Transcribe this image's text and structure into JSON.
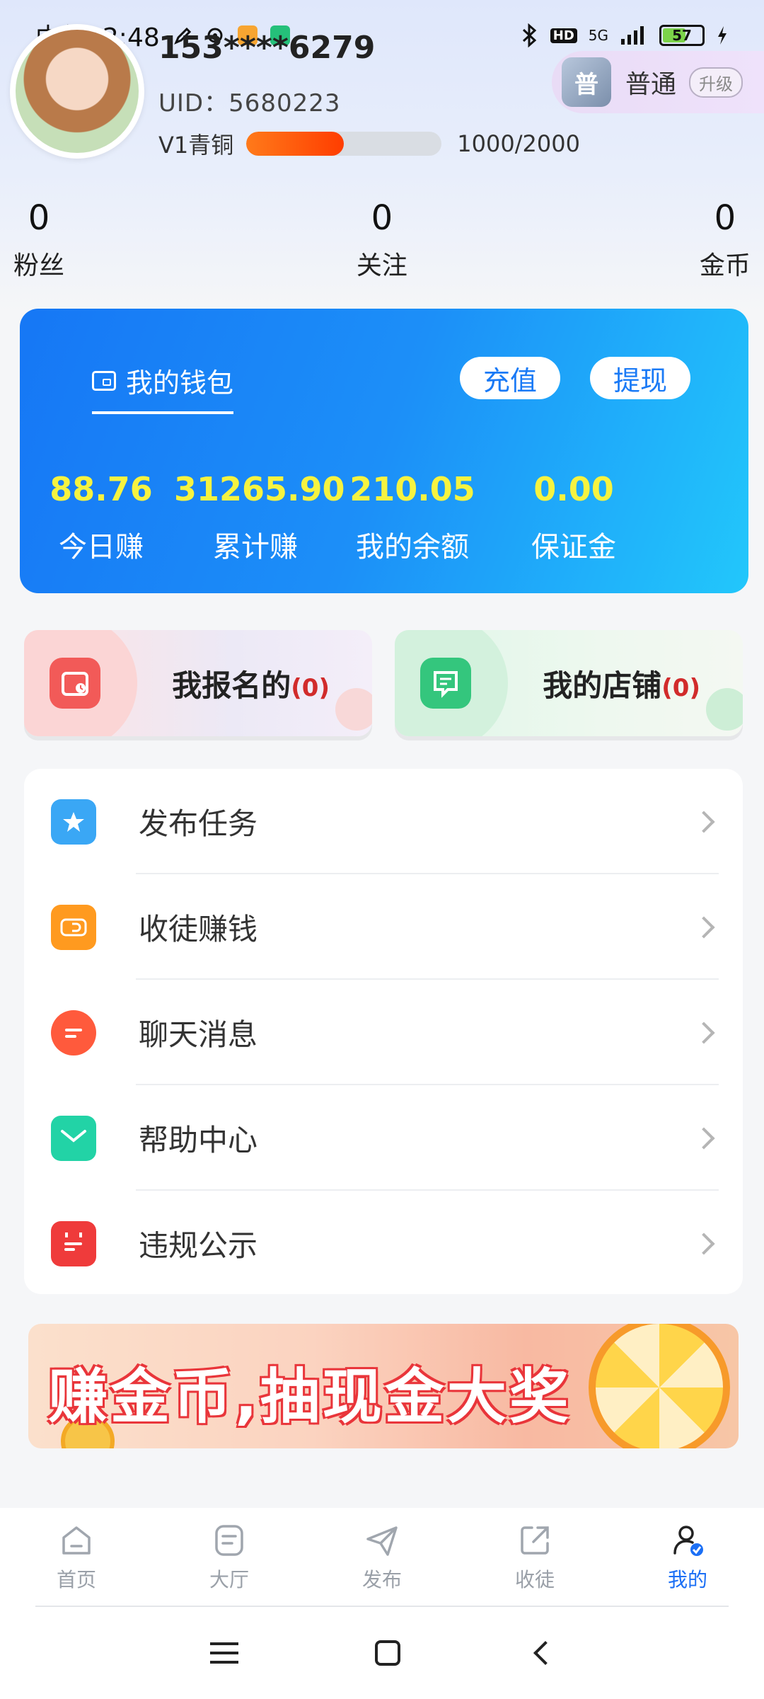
{
  "status_bar": {
    "time": "中午12:48",
    "network": "5G",
    "hd": "HD",
    "battery": "57"
  },
  "profile": {
    "username": "153****6279",
    "uid_label": "UID：5680223",
    "level_name": "V1青铜",
    "level_progress_text": "1000/2000",
    "level_progress_fraction": 0.5,
    "member": {
      "badge_glyph": "普",
      "tier": "普通",
      "upgrade_label": "升级"
    }
  },
  "stats": [
    {
      "value": "0",
      "label": "粉丝"
    },
    {
      "value": "0",
      "label": "关注"
    },
    {
      "value": "0",
      "label": "金币"
    }
  ],
  "wallet": {
    "title": "我的钱包",
    "recharge_label": "充值",
    "withdraw_label": "提现",
    "items": [
      {
        "value": "88.76",
        "label": "今日赚"
      },
      {
        "value": "31265.90",
        "label": "累计赚"
      },
      {
        "value": "210.05",
        "label": "我的余额"
      },
      {
        "value": "0.00",
        "label": "保证金"
      }
    ]
  },
  "quick_cards": {
    "signup": {
      "label": "我报名的",
      "count": "(0)"
    },
    "shop": {
      "label": "我的店铺",
      "count": "(0)"
    }
  },
  "menu": [
    {
      "label": "发布任务",
      "icon": "star-icon",
      "color": "#3aa7f5"
    },
    {
      "label": "收徒赚钱",
      "icon": "wallet-icon",
      "color": "#ff9a1f"
    },
    {
      "label": "聊天消息",
      "icon": "chat-icon",
      "color": "#ff5a3c"
    },
    {
      "label": "帮助中心",
      "icon": "mail-icon",
      "color": "#22d3a6"
    },
    {
      "label": "违规公示",
      "icon": "calendar-icon",
      "color": "#ef3b3b"
    }
  ],
  "banner": {
    "text": "赚金币,抽现金大奖"
  },
  "bottom_nav": [
    {
      "label": "首页",
      "icon": "home-icon"
    },
    {
      "label": "大厅",
      "icon": "hall-icon"
    },
    {
      "label": "发布",
      "icon": "send-icon"
    },
    {
      "label": "收徒",
      "icon": "share-icon"
    },
    {
      "label": "我的",
      "icon": "profile-icon",
      "active": true
    }
  ],
  "colors": {
    "accent": "#1b6ff5",
    "wallet_value": "#f6f340",
    "level_bar": "#ff5a10"
  }
}
